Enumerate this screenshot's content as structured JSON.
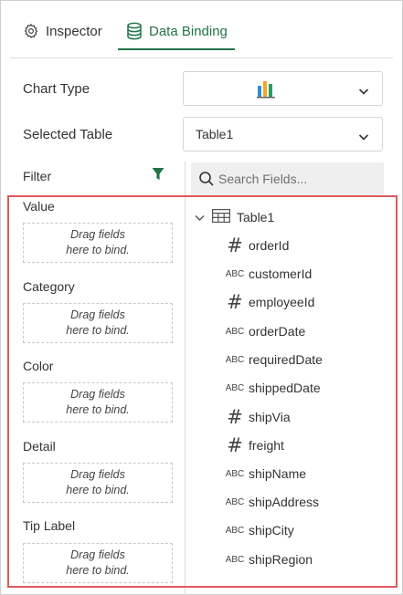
{
  "tabs": [
    {
      "label": "Inspector",
      "icon": "gear-icon",
      "active": false
    },
    {
      "label": "Data Binding",
      "icon": "database-icon",
      "active": true
    }
  ],
  "chart_type": {
    "label": "Chart Type",
    "icon": "bar-chart-icon"
  },
  "selected_table": {
    "label": "Selected Table",
    "value": "Table1"
  },
  "filter": {
    "label": "Filter",
    "icon": "filter-icon"
  },
  "search": {
    "placeholder": "Search Fields..."
  },
  "drop_zones": [
    {
      "label": "Value",
      "hint": "Drag fields\nhere to bind."
    },
    {
      "label": "Category",
      "hint": "Drag fields\nhere to bind."
    },
    {
      "label": "Color",
      "hint": "Drag fields\nhere to bind."
    },
    {
      "label": "Detail",
      "hint": "Drag fields\nhere to bind."
    },
    {
      "label": "Tip Label",
      "hint": "Drag fields\nhere to bind."
    }
  ],
  "tree": {
    "table_name": "Table1",
    "fields": [
      {
        "name": "orderId",
        "type": "number",
        "type_glyph": "#"
      },
      {
        "name": "customerId",
        "type": "string",
        "type_glyph": "ABC"
      },
      {
        "name": "employeeId",
        "type": "number",
        "type_glyph": "#"
      },
      {
        "name": "orderDate",
        "type": "string",
        "type_glyph": "ABC"
      },
      {
        "name": "requiredDate",
        "type": "string",
        "type_glyph": "ABC"
      },
      {
        "name": "shippedDate",
        "type": "string",
        "type_glyph": "ABC"
      },
      {
        "name": "shipVia",
        "type": "number",
        "type_glyph": "#"
      },
      {
        "name": "freight",
        "type": "number",
        "type_glyph": "#"
      },
      {
        "name": "shipName",
        "type": "string",
        "type_glyph": "ABC"
      },
      {
        "name": "shipAddress",
        "type": "string",
        "type_glyph": "ABC"
      },
      {
        "name": "shipCity",
        "type": "string",
        "type_glyph": "ABC"
      },
      {
        "name": "shipRegion",
        "type": "string",
        "type_glyph": "ABC"
      }
    ]
  },
  "colors": {
    "accent": "#217346",
    "highlight": "#e05858",
    "chart_bars": [
      "#2f8fd6",
      "#f5a623",
      "#2e9b5f"
    ]
  }
}
